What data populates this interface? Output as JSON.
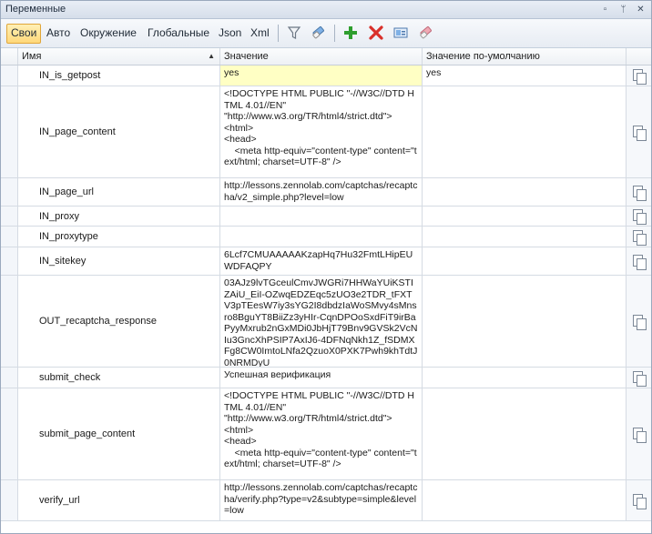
{
  "panel": {
    "title": "Переменные",
    "title_buttons": [
      "▫",
      "ᛘ",
      "✕"
    ]
  },
  "toolbar": {
    "tabs": [
      "Свои",
      "Авто",
      "Окружение",
      "Глобальные",
      "Json",
      "Xml"
    ],
    "active_tab": "Свои",
    "icons": [
      "filter-icon",
      "eraser-icon",
      "add-icon",
      "delete-icon",
      "edit-icon",
      "clear-icon"
    ],
    "colors": {
      "accent": "#ffd87a",
      "add": "#2e9e2e",
      "delete": "#d9302a"
    }
  },
  "grid": {
    "columns": [
      "Имя",
      "Значение",
      "Значение по-умолчанию"
    ],
    "sort_indicator": "▲",
    "rows": [
      {
        "name": "IN_is_getpost",
        "value": "yes",
        "default": "yes",
        "highlight": true
      },
      {
        "name": "IN_page_content",
        "value": "<!DOCTYPE HTML PUBLIC \"-//W3C//DTD HTML 4.01//EN\"\n\"http://www.w3.org/TR/html4/strict.dtd\">\n<html>\n<head>\n    <meta http-equiv=\"content-type\" content=\"text/html; charset=UTF-8\" />",
        "default": ""
      },
      {
        "name": "IN_page_url",
        "value": "http://lessons.zennolab.com/captchas/recaptcha/v2_simple.php?level=low",
        "default": ""
      },
      {
        "name": "IN_proxy",
        "value": "",
        "default": ""
      },
      {
        "name": "IN_proxytype",
        "value": "",
        "default": ""
      },
      {
        "name": "IN_sitekey",
        "value": "6Lcf7CMUAAAAAKzapHq7Hu32FmtLHipEUWDFAQPY",
        "default": ""
      },
      {
        "name": "OUT_recaptcha_response",
        "value": "03AJz9lvTGceulCmvJWGRi7HHWaYUiKSTIZAiU_EiI-OZwqEDZEqc5zUO3e2TDR_tFXTV3pTEesW7iy3sYG2I8dbdzIaWoSMvy4sMnsro8BguYT8BiiZz3yHIr-CqnDPOoSxdFiT9irBaPyyMxrub2nGxMDi0JbHjT79Bnv9GVSk2VcNIu3GncXhPSIP7AxIJ6-4DFNqNkh1Z_fSDMXFg8CW0ImtoLNfa2QzuoX0PXK7Pwh9khTdtJ0NRMDyU",
        "default": ""
      },
      {
        "name": "submit_check",
        "value": "Успешная верификация",
        "default": ""
      },
      {
        "name": "submit_page_content",
        "value": "<!DOCTYPE HTML PUBLIC \"-//W3C//DTD HTML 4.01//EN\"\n\"http://www.w3.org/TR/html4/strict.dtd\">\n<html>\n<head>\n    <meta http-equiv=\"content-type\" content=\"text/html; charset=UTF-8\" />",
        "default": ""
      },
      {
        "name": "verify_url",
        "value": "http://lessons.zennolab.com/captchas/recaptcha/verify.php?type=v2&subtype=simple&level=low",
        "default": ""
      }
    ]
  }
}
